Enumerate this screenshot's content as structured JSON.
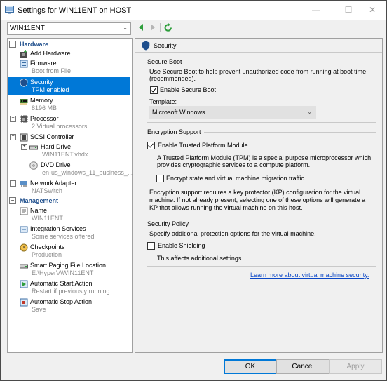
{
  "window": {
    "title": "Settings for WIN11ENT on HOST",
    "minimize": "—",
    "maximize": "☐",
    "close": "✕"
  },
  "vm_selector": {
    "value": "WIN11ENT",
    "icon": "chevron-down-icon"
  },
  "toolbar": {
    "back_icon": "back-arrow-icon",
    "forward_icon": "forward-arrow-icon",
    "refresh_icon": "refresh-icon"
  },
  "sidebar": {
    "hardware_header": "Hardware",
    "hardware_toggle": "−",
    "management_header": "Management",
    "management_toggle": "−",
    "hardware_items": [
      {
        "label": "Add Hardware",
        "sub": ""
      },
      {
        "label": "Firmware",
        "sub": "Boot from File"
      },
      {
        "label": "Security",
        "sub": "TPM enabled"
      },
      {
        "label": "Memory",
        "sub": "8196 MB"
      },
      {
        "label": "Processor",
        "sub": "2 Virtual processors",
        "toggle": "+"
      },
      {
        "label": "SCSI Controller",
        "sub": "",
        "toggle": "−"
      },
      {
        "label": "Hard Drive",
        "sub": "WIN11ENT.vhdx",
        "toggle": "+"
      },
      {
        "label": "DVD Drive",
        "sub": "en-us_windows_11_business_..."
      },
      {
        "label": "Network Adapter",
        "sub": "NATSwitch",
        "toggle": "+"
      }
    ],
    "management_items": [
      {
        "label": "Name",
        "sub": "WIN11ENT"
      },
      {
        "label": "Integration Services",
        "sub": "Some services offered"
      },
      {
        "label": "Checkpoints",
        "sub": "Production"
      },
      {
        "label": "Smart Paging File Location",
        "sub": "E:\\HyperV\\WIN11ENT"
      },
      {
        "label": "Automatic Start Action",
        "sub": "Restart if previously running"
      },
      {
        "label": "Automatic Stop Action",
        "sub": "Save"
      }
    ]
  },
  "panel": {
    "title": "Security",
    "secure_boot": {
      "heading": "Secure Boot",
      "desc_line1": "Use Secure Boot to help prevent unauthorized code from running at boot time",
      "desc_line2": "(recommended).",
      "enable_label": "Enable Secure Boot",
      "enabled": true,
      "template_label": "Template:",
      "template_value": "Microsoft Windows"
    },
    "encryption": {
      "heading": "Encryption Support",
      "tpm_label": "Enable Trusted Platform Module",
      "tpm_enabled": true,
      "tpm_desc_line1": "A Trusted Platform Module (TPM) is a special purpose microprocessor which",
      "tpm_desc_line2": "provides cryptographic services to a compute platform.",
      "encrypt_label": "Encrypt state and virtual machine migration traffic",
      "encrypt_enabled": false,
      "note_line1": "Encryption support requires a key protector (KP) configuration for the virtual",
      "note_line2": "machine. If not already present, selecting one of these options will generate a",
      "note_line3": "KP that allows running the virtual machine on this host."
    },
    "policy": {
      "heading": "Security Policy",
      "desc": "Specify additional protection options for the virtual machine.",
      "shield_label": "Enable Shielding",
      "shield_enabled": false,
      "shield_note": "This affects additional settings."
    },
    "learn_more": "Learn more about virtual machine security."
  },
  "buttons": {
    "ok": "OK",
    "cancel": "Cancel",
    "apply": "Apply"
  },
  "colors": {
    "selection": "#0078d7",
    "header_text": "#1e4e8c",
    "link": "#0b47c6",
    "nav_green": "#2e9e3c"
  }
}
